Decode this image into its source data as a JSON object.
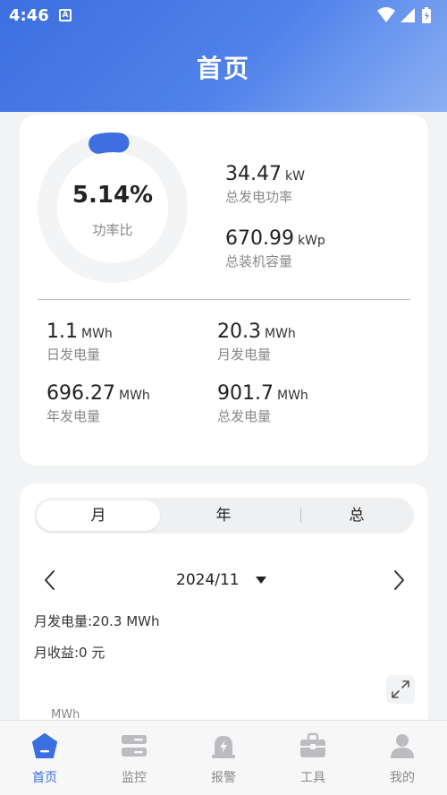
{
  "status_bar": {
    "time": "4:46",
    "notification_glyph": "A"
  },
  "header": {
    "title": "首页"
  },
  "summary": {
    "power_ratio": {
      "value": "5.14%",
      "label": "功率比",
      "fraction": 0.0514
    },
    "current_power": {
      "value": "34.47",
      "unit": "kW",
      "label": "总发电功率"
    },
    "installed_capacity": {
      "value": "670.99",
      "unit": "kWp",
      "label": "总装机容量"
    },
    "daily": {
      "value": "1.1",
      "unit": "MWh",
      "label": "日发电量"
    },
    "monthly": {
      "value": "20.3",
      "unit": "MWh",
      "label": "月发电量"
    },
    "yearly": {
      "value": "696.27",
      "unit": "MWh",
      "label": "年发电量"
    },
    "total": {
      "value": "901.7",
      "unit": "MWh",
      "label": "总发电量"
    }
  },
  "period_card": {
    "tabs": [
      {
        "label": "月",
        "active": true
      },
      {
        "label": "年",
        "active": false
      },
      {
        "label": "总",
        "active": false
      }
    ],
    "selected_date": "2024/11",
    "generation_line": "月发电量:20.3 MWh",
    "revenue_line": "月收益:0 元",
    "chart_unit": "MWh"
  },
  "bottom_nav": [
    {
      "label": "首页",
      "icon": "home-icon",
      "active": true
    },
    {
      "label": "监控",
      "icon": "monitor-icon",
      "active": false
    },
    {
      "label": "报警",
      "icon": "alarm-icon",
      "active": false
    },
    {
      "label": "工具",
      "icon": "toolbox-icon",
      "active": false
    },
    {
      "label": "我的",
      "icon": "user-icon",
      "active": false
    }
  ],
  "colors": {
    "accent": "#3b6fe0",
    "header_start": "#3d6fe0",
    "header_end": "#8cb0f2",
    "inactive": "#bcbcc0"
  }
}
